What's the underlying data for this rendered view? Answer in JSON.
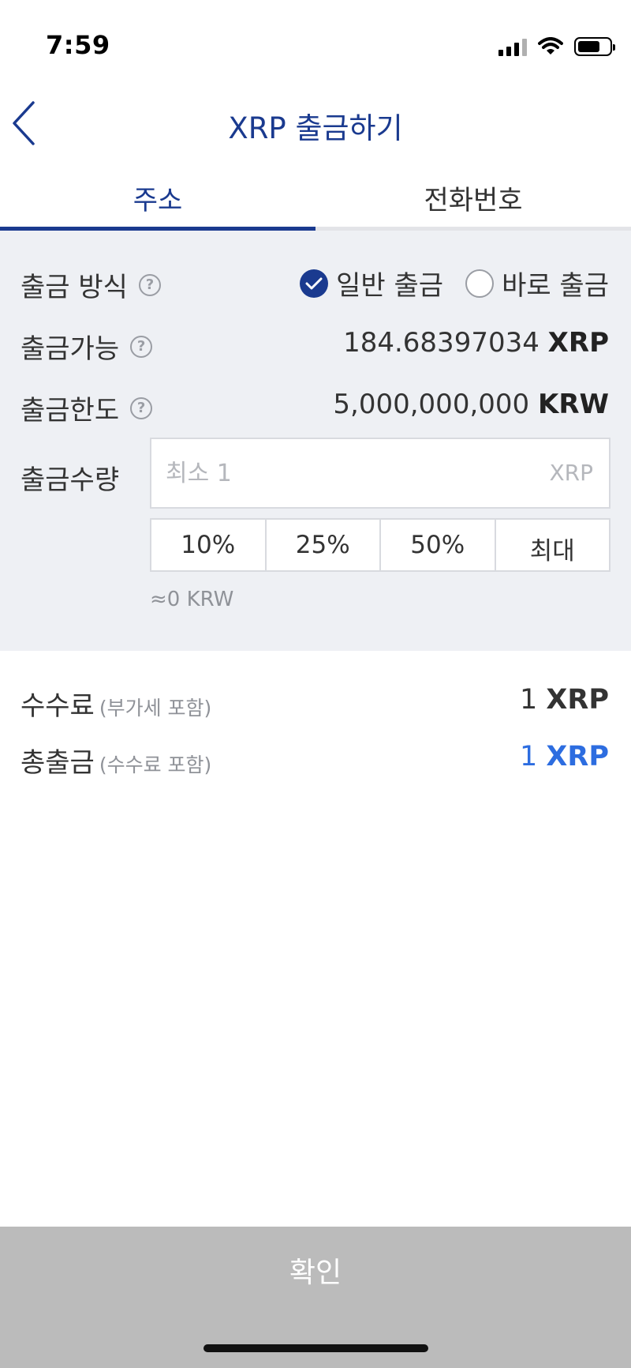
{
  "status_bar": {
    "time": "7:59",
    "icons": [
      "signal-icon",
      "wifi-icon",
      "battery-icon"
    ]
  },
  "header": {
    "title": "XRP 출금하기",
    "back_icon": "chevron-left-icon"
  },
  "tabs": [
    {
      "label": "주소",
      "active": true
    },
    {
      "label": "전화번호",
      "active": false
    }
  ],
  "form": {
    "method": {
      "label": "출금 방식",
      "options": [
        {
          "label": "일반 출금",
          "checked": true
        },
        {
          "label": "바로 출금",
          "checked": false
        }
      ]
    },
    "available": {
      "label": "출금가능",
      "amount": "184.68397034",
      "unit": "XRP"
    },
    "limit": {
      "label": "출금한도",
      "amount": "5,000,000,000",
      "unit": "KRW"
    },
    "quantity": {
      "label": "출금수량",
      "value": "",
      "placeholder": "최소 1",
      "unit": "XRP"
    },
    "percent_buttons": [
      "10%",
      "25%",
      "50%",
      "최대"
    ],
    "krw_estimate": "≈0 KRW"
  },
  "fees": {
    "fee": {
      "label": "수수료",
      "note": "(부가세 포함)",
      "amount": "1",
      "unit": "XRP"
    },
    "total": {
      "label": "총출금",
      "note": "(수수료 포함)",
      "amount": "1",
      "unit": "XRP"
    }
  },
  "confirm_label": "확인",
  "colors": {
    "brand": "#1a3a8f",
    "total_accent": "#2d6de0",
    "panel_bg": "#eef0f4",
    "button_disabled": "#bbbbbb"
  }
}
